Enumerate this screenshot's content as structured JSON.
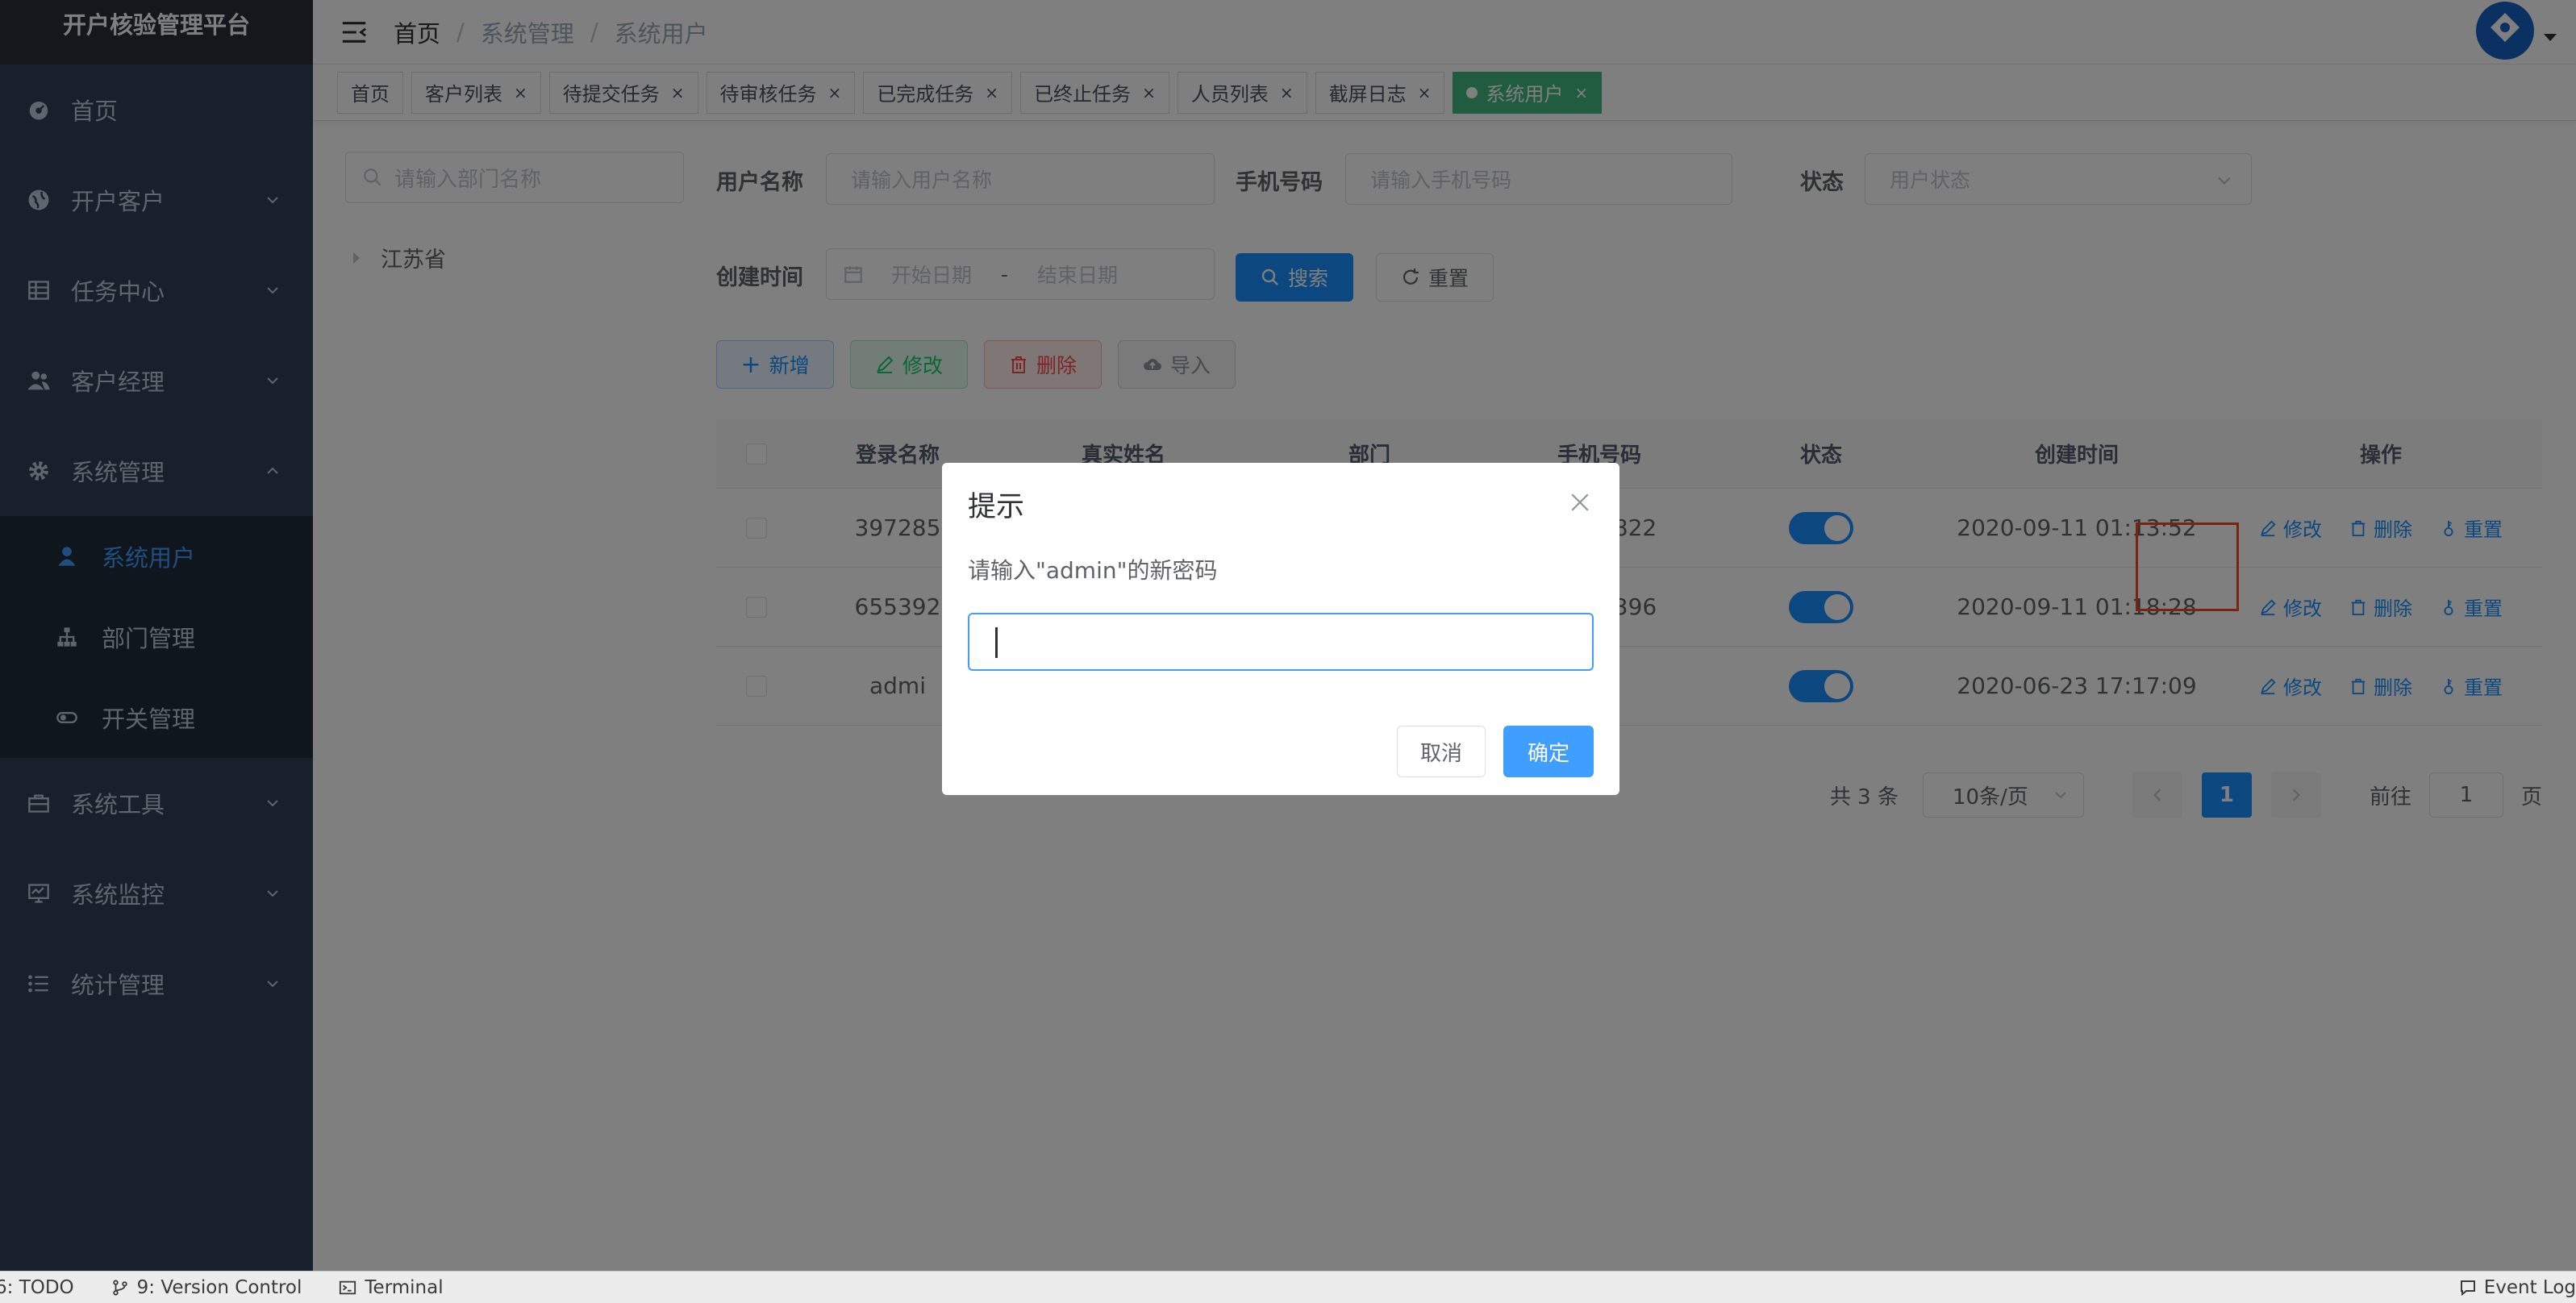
{
  "app": {
    "title": "开户核验管理平台"
  },
  "sidebar": {
    "items": [
      {
        "label": "首页",
        "icon": "dashboard-icon"
      },
      {
        "label": "开户客户",
        "icon": "globe-icon"
      },
      {
        "label": "任务中心",
        "icon": "table-icon"
      },
      {
        "label": "客户经理",
        "icon": "peoples-icon"
      },
      {
        "label": "系统管理",
        "icon": "gear-icon"
      }
    ],
    "sub_items": [
      {
        "label": "系统用户",
        "icon": "user-icon",
        "active": true
      },
      {
        "label": "部门管理",
        "icon": "tree-icon"
      },
      {
        "label": "开关管理",
        "icon": "toggle-icon"
      }
    ],
    "items_after": [
      {
        "label": "系统工具",
        "icon": "toolbox-icon"
      },
      {
        "label": "系统监控",
        "icon": "monitor-icon"
      },
      {
        "label": "统计管理",
        "icon": "list-icon"
      }
    ]
  },
  "breadcrumb": [
    "首页",
    "系统管理",
    "系统用户"
  ],
  "tags": [
    {
      "label": "首页"
    },
    {
      "label": "客户列表"
    },
    {
      "label": "待提交任务"
    },
    {
      "label": "待审核任务"
    },
    {
      "label": "已完成任务"
    },
    {
      "label": "已终止任务"
    },
    {
      "label": "人员列表"
    },
    {
      "label": "截屏日志"
    },
    {
      "label": "系统用户",
      "active": true
    }
  ],
  "dept_search": {
    "placeholder": "请输入部门名称"
  },
  "tree": {
    "root": "江苏省"
  },
  "form": {
    "username_label": "用户名称",
    "username_placeholder": "请输入用户名称",
    "phone_label": "手机号码",
    "phone_placeholder": "请输入手机号码",
    "status_label": "状态",
    "status_placeholder": "用户状态",
    "created_label": "创建时间",
    "start_placeholder": "开始日期",
    "range_sep": "-",
    "end_placeholder": "结束日期",
    "search_btn": "搜索",
    "reset_btn": "重置"
  },
  "toolbar": {
    "add": "新增",
    "edit": "修改",
    "delete": "删除",
    "import": "导入"
  },
  "table": {
    "headers": [
      "登录名称",
      "真实姓名",
      "部门",
      "手机号码",
      "状态",
      "创建时间",
      "操作"
    ],
    "rows": [
      {
        "login": "397285",
        "real": "",
        "dept": "",
        "phone": "51620822",
        "time": "2020-09-11 01:13:52"
      },
      {
        "login": "655392",
        "real": "",
        "dept": "",
        "phone": "30557396",
        "time": "2020-09-11 01:18:28"
      },
      {
        "login": "admi",
        "real": "",
        "dept": "",
        "phone": "",
        "time": "2020-06-23 17:17:09"
      }
    ],
    "op_edit": "修改",
    "op_delete": "删除",
    "op_reset": "重置"
  },
  "pagination": {
    "total": "共 3 条",
    "page_size": "10条/页",
    "current": "1",
    "goto_prefix": "前往",
    "goto_value": "1",
    "goto_suffix": "页"
  },
  "dialog": {
    "title": "提示",
    "message": "请输入\"admin\"的新密码",
    "cancel": "取消",
    "confirm": "确定"
  },
  "statusbar": {
    "todo": "6: TODO",
    "vcs": "9: Version Control",
    "terminal": "Terminal",
    "event_log": "Event Log"
  },
  "colors": {
    "sidebar_bg": "#304156",
    "primary": "#1890ff",
    "highlight": "#f04a20",
    "tag_active": "#42b983"
  }
}
